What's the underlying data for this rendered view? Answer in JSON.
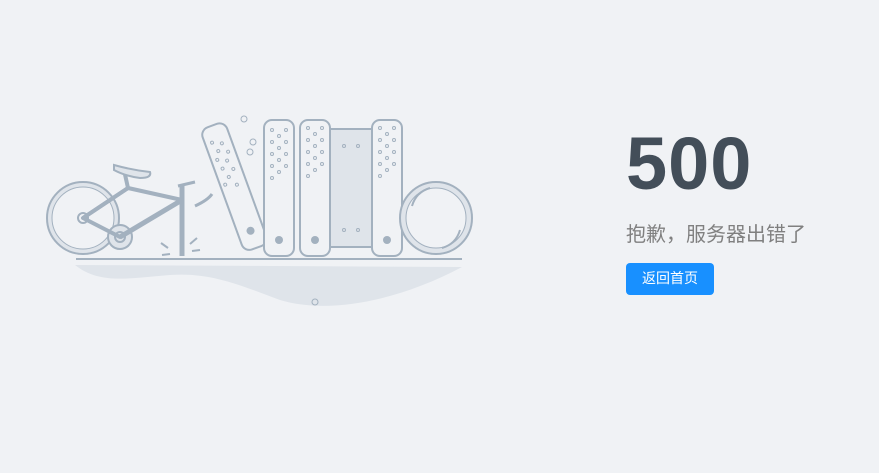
{
  "error": {
    "code": "500",
    "description": "抱歉，服务器出错了",
    "back_button_label": "返回首页"
  },
  "colors": {
    "background": "#f0f2f5",
    "code_text": "#434e59",
    "description_text": "#808080",
    "button_bg": "#1890ff",
    "illustration_stroke": "#a3b1bf",
    "illustration_fill": "#dfe4ea"
  },
  "illustration": {
    "subject": "bicycle-and-books-illustration"
  }
}
